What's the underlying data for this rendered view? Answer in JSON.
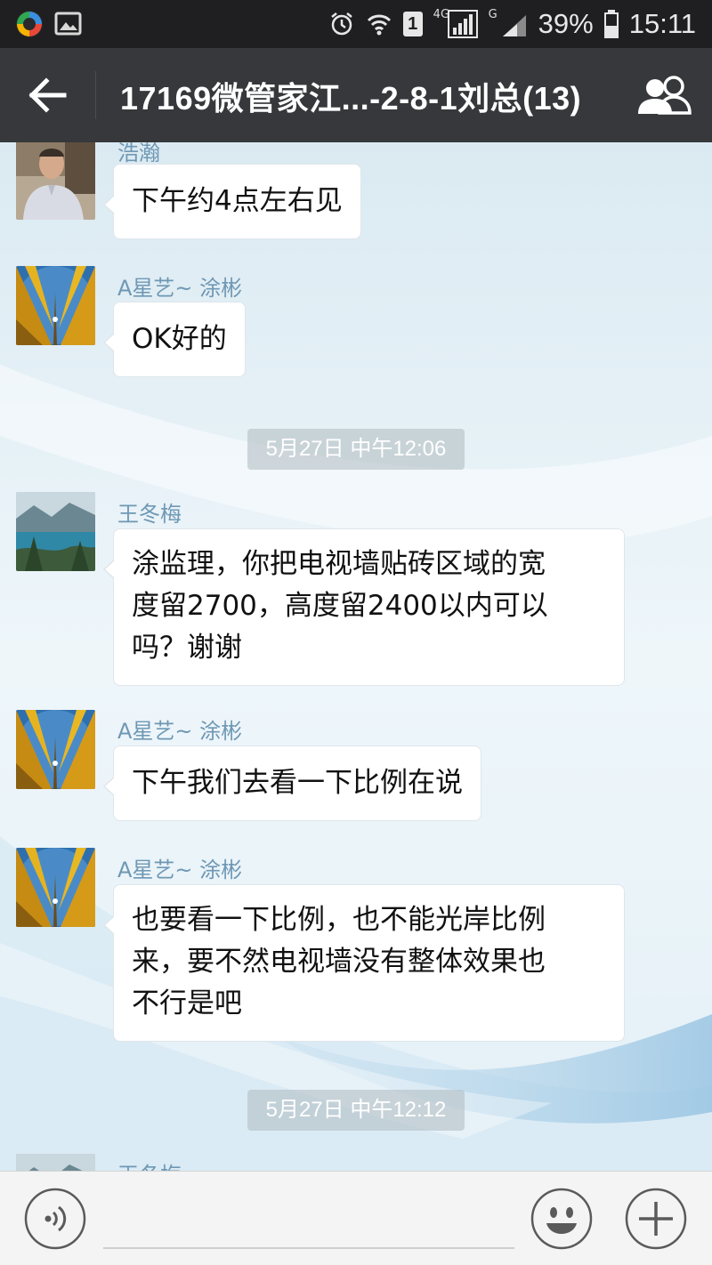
{
  "status_bar": {
    "sim_slot": "1",
    "network": "4G",
    "network2": "G",
    "battery": "39%",
    "time": "15:11",
    "icons": [
      "app-logo-icon",
      "image-notification-icon",
      "alarm-icon",
      "wifi-icon",
      "sim-icon",
      "signal-icon",
      "battery-icon"
    ]
  },
  "header": {
    "title": "17169微管家江...-2-8-1刘总(13)",
    "back_icon": "back-arrow-icon",
    "group_icon": "group-members-icon"
  },
  "messages": [
    {
      "sender": "浩瀚",
      "lines": [
        "下午约4点左右见"
      ]
    },
    {
      "sender": "A星艺~ 涂彬",
      "lines": [
        "OK好的"
      ]
    },
    {
      "timestamp": "5月27日 中午12:06"
    },
    {
      "sender": "王冬梅",
      "lines": [
        "涂监理，你把电视墙贴砖区域的宽",
        "度留2700，高度留2400以内可以",
        "吗？谢谢"
      ]
    },
    {
      "sender": "A星艺~ 涂彬",
      "lines": [
        "下午我们去看一下比例在说"
      ]
    },
    {
      "sender": "A星艺~ 涂彬",
      "lines": [
        "也要看一下比例，也不能光岸比例",
        "来，要不然电视墙没有整体效果也",
        "不行是吧"
      ]
    },
    {
      "timestamp": "5月27日 中午12:12"
    },
    {
      "sender": "王冬梅"
    }
  ],
  "input_bar": {
    "icons": [
      "voice-icon",
      "emoji-icon",
      "plus-icon"
    ]
  },
  "colors": {
    "status_bar": "#1f1f21",
    "title_bar": "#36383b",
    "sender_name": "#6f98b4",
    "bubble": "#ffffff",
    "timestamp_bg": "#afb9c0"
  }
}
